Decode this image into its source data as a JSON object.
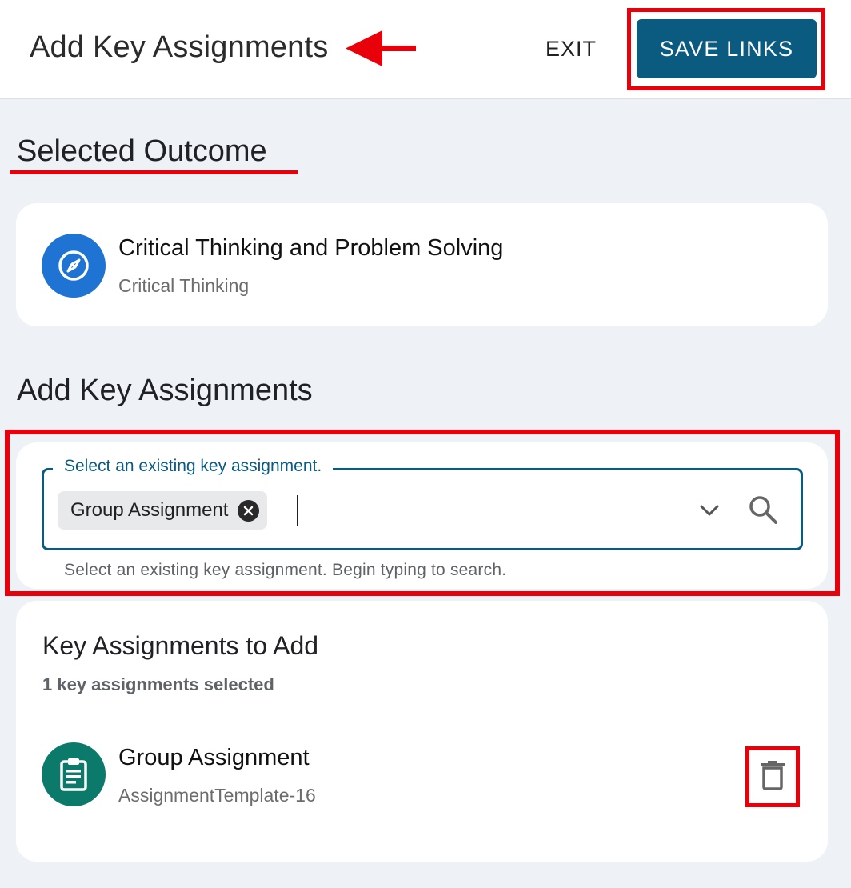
{
  "header": {
    "title": "Add Key Assignments",
    "exit_label": "EXIT",
    "save_label": "SAVE LINKS"
  },
  "selected_outcome": {
    "heading": "Selected Outcome",
    "title": "Critical Thinking and Problem Solving",
    "subtitle": "Critical Thinking",
    "icon": "compass-icon"
  },
  "add_section": {
    "heading": "Add Key Assignments",
    "field_label": "Select an existing key assignment.",
    "chip_label": "Group Assignment",
    "helper_text": "Select an existing key assignment. Begin typing to search."
  },
  "to_add": {
    "heading": "Key Assignments to Add",
    "count_text": "1 key assignments selected",
    "items": [
      {
        "title": "Group Assignment",
        "subtitle": "AssignmentTemplate-16",
        "icon": "clipboard-icon"
      }
    ]
  },
  "colors": {
    "primary": "#0b5a80",
    "annotation_red": "#e8000b",
    "outcome_icon_bg": "#1f73d2",
    "assignment_icon_bg": "#0c7a6a",
    "page_bg": "#eef1f6"
  }
}
